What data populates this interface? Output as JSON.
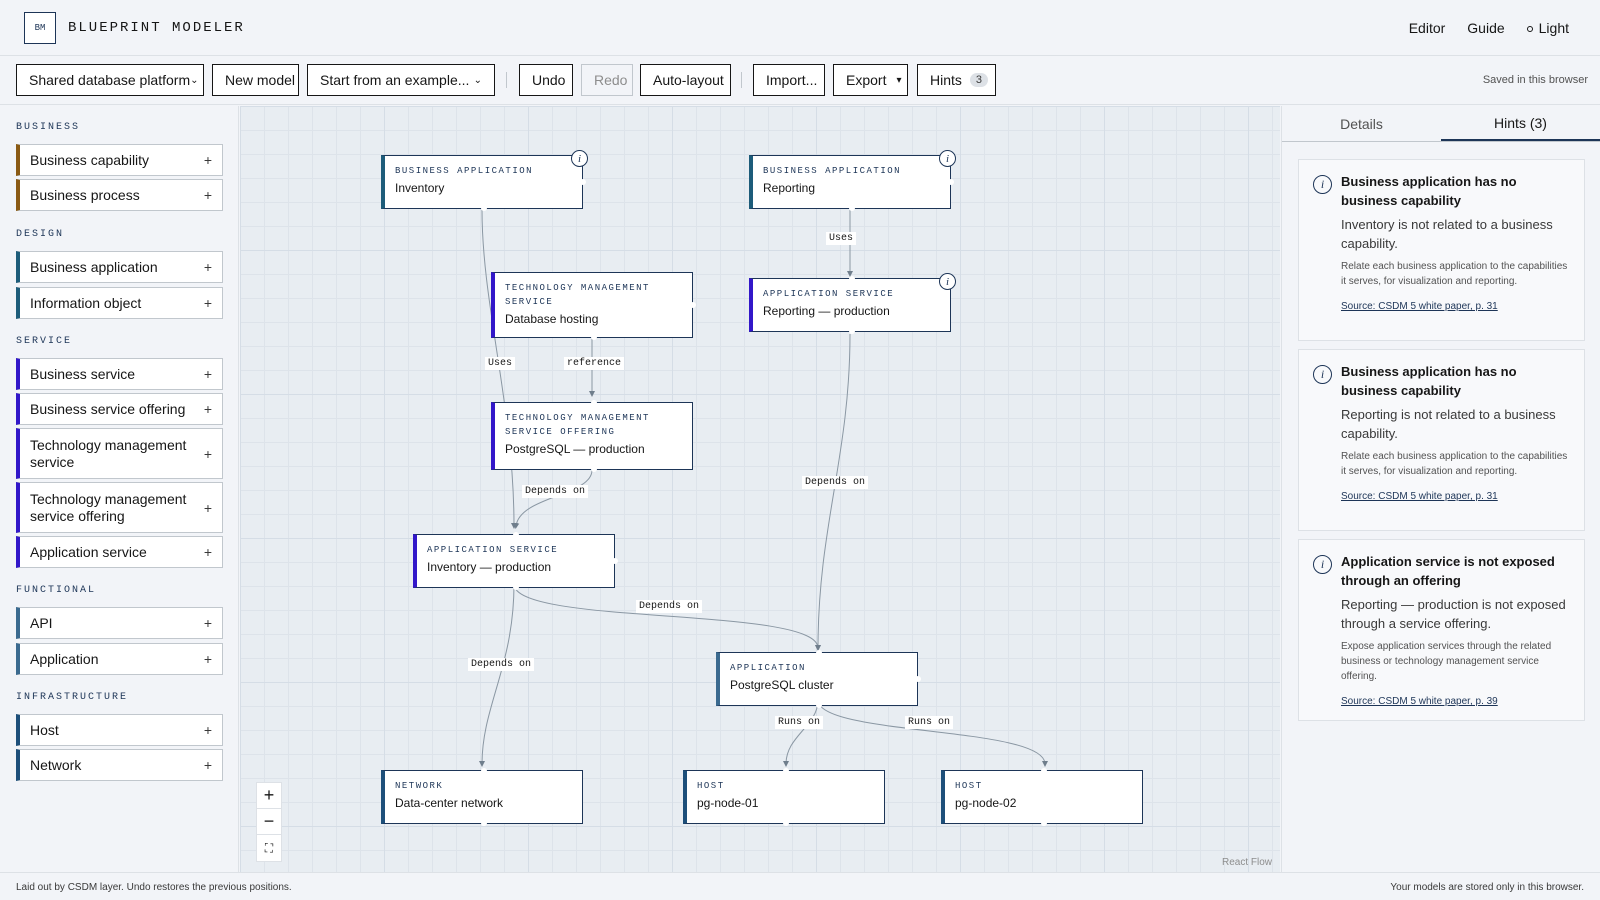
{
  "header": {
    "logo": "BM",
    "title": "BLUEPRINT MODELER",
    "nav": [
      "Editor",
      "Guide"
    ],
    "theme_label": "Light"
  },
  "toolbar": {
    "model_select": "Shared database platform",
    "new_model": "New model",
    "example_select": "Start from an example...",
    "undo": "Undo",
    "redo": "Redo",
    "auto_layout": "Auto-layout",
    "import": "Import...",
    "export": "Export",
    "hints": "Hints",
    "hints_count": "3",
    "saved_status": "Saved in this browser"
  },
  "sidebar": {
    "sections": [
      {
        "title": "BUSINESS",
        "items": [
          "Business capability",
          "Business process"
        ]
      },
      {
        "title": "DESIGN",
        "items": [
          "Business application",
          "Information object"
        ]
      },
      {
        "title": "SERVICE",
        "items": [
          "Business service",
          "Business service offering",
          "Technology management service",
          "Technology management service offering",
          "Application service"
        ]
      },
      {
        "title": "FUNCTIONAL",
        "items": [
          "API",
          "Application"
        ]
      },
      {
        "title": "INFRASTRUCTURE",
        "items": [
          "Host",
          "Network"
        ]
      }
    ],
    "colors": {
      "business": "#8a5a14",
      "design": "#1d5c7a",
      "service": "#3217c9",
      "functional": "#3b6a8f",
      "infrastructure": "#1d4f7a"
    }
  },
  "canvas": {
    "nodes": [
      {
        "type": "BUSINESS APPLICATION",
        "name": "Inventory",
        "hint": true
      },
      {
        "type": "BUSINESS APPLICATION",
        "name": "Reporting",
        "hint": true
      },
      {
        "type": "TECHNOLOGY MANAGEMENT SERVICE",
        "name": "Database hosting",
        "hint": false
      },
      {
        "type": "APPLICATION SERVICE",
        "name": "Reporting — production",
        "hint": true
      },
      {
        "type": "TECHNOLOGY MANAGEMENT SERVICE OFFERING",
        "name": "PostgreSQL — production",
        "hint": false
      },
      {
        "type": "APPLICATION SERVICE",
        "name": "Inventory — production",
        "hint": false
      },
      {
        "type": "APPLICATION",
        "name": "PostgreSQL cluster",
        "hint": false
      },
      {
        "type": "NETWORK",
        "name": "Data-center network",
        "hint": false
      },
      {
        "type": "HOST",
        "name": "pg-node-01",
        "hint": false
      },
      {
        "type": "HOST",
        "name": "pg-node-02",
        "hint": false
      }
    ],
    "edge_labels": [
      "Uses",
      "Uses",
      "reference",
      "Depends on",
      "Depends on",
      "Depends on",
      "Depends on",
      "Runs on",
      "Runs on"
    ],
    "info_icon": "i",
    "zoom_in": "+",
    "zoom_out": "−",
    "fit_view": "⛶",
    "attribution": "React Flow"
  },
  "panel": {
    "tabs": [
      "Details",
      "Hints (3)"
    ],
    "active_tab": "Hints (3)",
    "hints": [
      {
        "title": "Business application has no business capability",
        "message": "Inventory is not related to a business capability.",
        "description": "Relate each business application to the capabilities it serves, for visualization and reporting.",
        "source": "Source: CSDM 5 white paper, p. 31"
      },
      {
        "title": "Business application has no business capability",
        "message": "Reporting is not related to a business capability.",
        "description": "Relate each business application to the capabilities it serves, for visualization and reporting.",
        "source": "Source: CSDM 5 white paper, p. 31"
      },
      {
        "title": "Application service is not exposed through an offering",
        "message": "Reporting — production is not exposed through a service offering.",
        "description": "Expose application services through the related business or technology management service offering.",
        "source": "Source: CSDM 5 white paper, p. 39"
      }
    ]
  },
  "footer": {
    "left": "Laid out by CSDM layer. Undo restores the previous positions.",
    "right": "Your models are stored only in this browser."
  }
}
